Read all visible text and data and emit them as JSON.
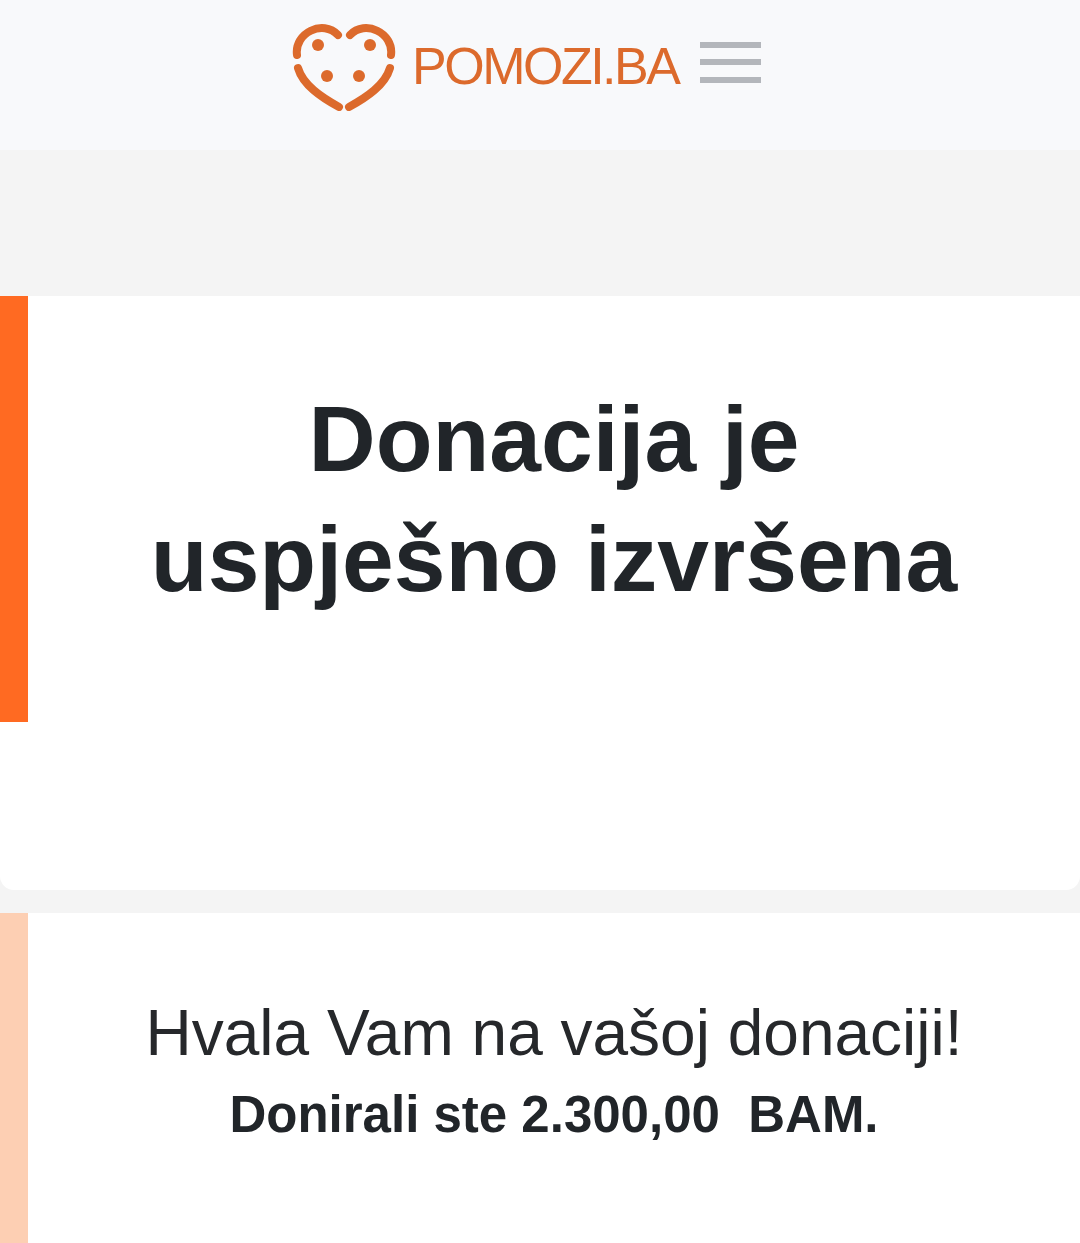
{
  "header": {
    "logo_text": "POMOZI.BA"
  },
  "cards": [
    {
      "kind": "title",
      "title": "Donacija je uspješno izvršena",
      "color": "#ff6a22"
    },
    {
      "kind": "message",
      "message": "Hvala Vam na vašoj donaciji!",
      "amount_line": "Donirali ste 2.300,00  BAM.",
      "color": "#fdcfb3"
    }
  ]
}
